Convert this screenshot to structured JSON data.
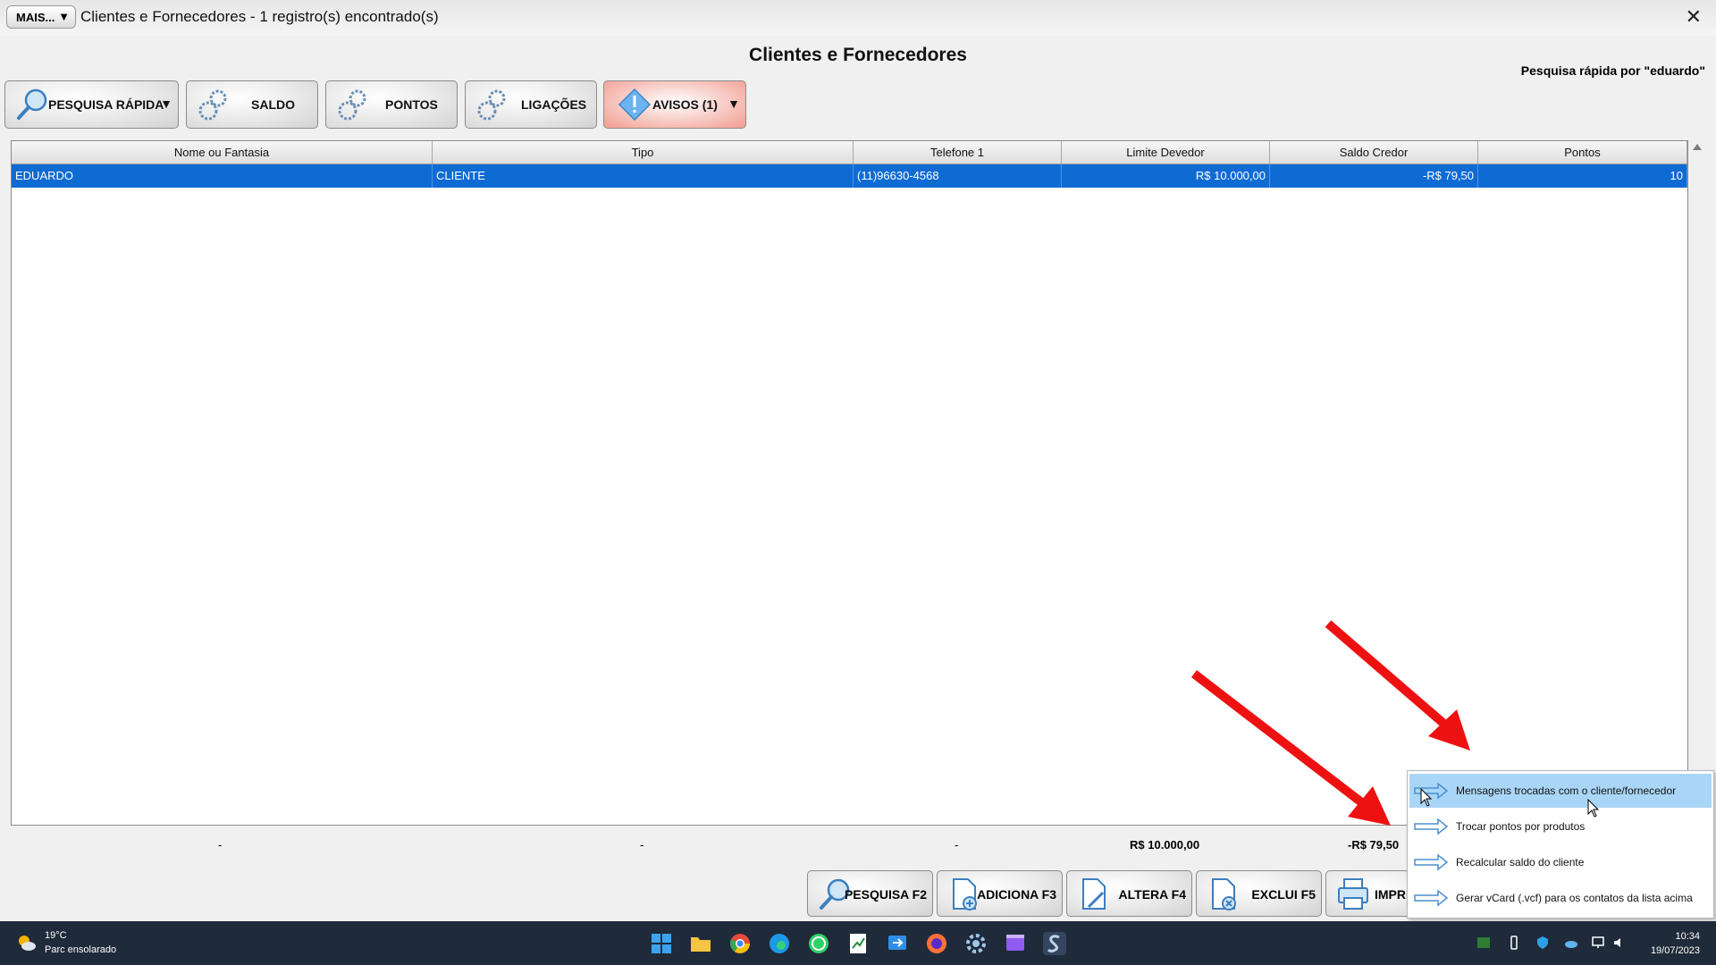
{
  "window": {
    "more_button": "MAIS...",
    "title": "Clientes e Fornecedores - 1 registro(s) encontrado(s)",
    "close": "✕"
  },
  "heading": "Clientes e Fornecedores",
  "search_note": "Pesquisa rápida por \"eduardo\"",
  "toolbar": {
    "quick_search": "PESQUISA RÁPIDA",
    "saldo": "SALDO",
    "pontos": "PONTOS",
    "ligacoes": "LIGAÇÕES",
    "avisos": "AVISOS (1)"
  },
  "table": {
    "columns": [
      "Nome ou Fantasia",
      "Tipo",
      "Telefone 1",
      "Limite Devedor",
      "Saldo Credor",
      "Pontos"
    ],
    "rows": [
      [
        "EDUARDO",
        "CLIENTE",
        "(11)96630-4568",
        "R$ 10.000,00",
        "-R$ 79,50",
        "10"
      ]
    ]
  },
  "totals": {
    "nome": "-",
    "tipo": "-",
    "telefone": "-",
    "limite": "R$ 10.000,00",
    "saldo": "-R$ 79,50"
  },
  "bottom_buttons": {
    "pesquisa": "PESQUISA F2",
    "adiciona": "ADICIONA F3",
    "altera": "ALTERA F4",
    "exclui": "EXCLUI F5",
    "imprime": "IMPRI"
  },
  "context_menu": [
    "Mensagens trocadas com o cliente/fornecedor",
    "Trocar pontos por produtos",
    "Recalcular saldo do cliente",
    "Gerar vCard (.vcf) para os contatos da lista acima"
  ],
  "taskbar": {
    "temperature": "19°C",
    "condition": "Parc ensolarado",
    "time": "10:34",
    "date": "19/07/2023"
  },
  "colors": {
    "selection": "#0f6bd4",
    "menu_highlight": "#a9d6f7",
    "annotation": "#ee1111",
    "taskbar": "#1f2a3a"
  }
}
